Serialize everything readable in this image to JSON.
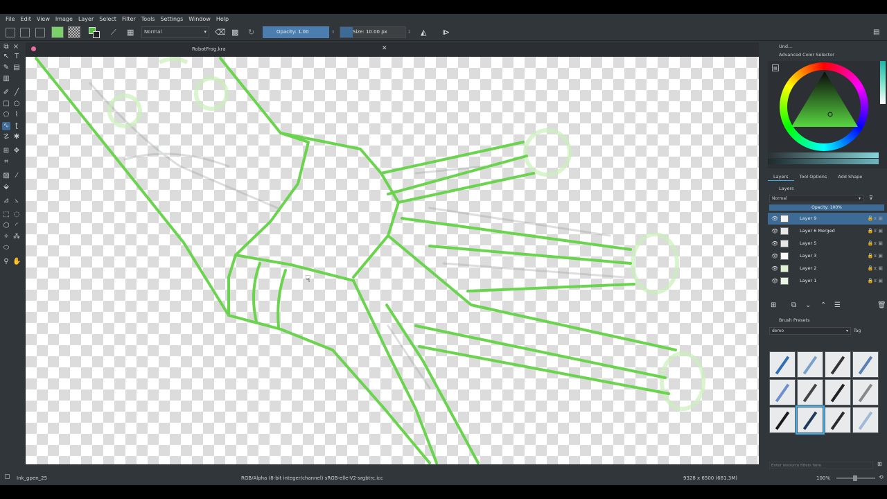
{
  "menu": [
    "File",
    "Edit",
    "View",
    "Image",
    "Layer",
    "Select",
    "Filter",
    "Tools",
    "Settings",
    "Window",
    "Help"
  ],
  "toolbar": {
    "blend_mode": "Normal",
    "opacity": "Opacity: 1.00",
    "size": "Size: 10.00 px",
    "fg_color": "#7bd06a"
  },
  "document": {
    "title": "RobotFrog.kra"
  },
  "docker": {
    "undo_title": "Und...",
    "color_selector_title": "Advanced Color Selector",
    "tabs": [
      "Layers",
      "Tool Options",
      "Add Shape"
    ],
    "layers_title": "Layers",
    "layer_blend": "Normal",
    "layer_opacity": "Opacity: 100%",
    "layers": [
      {
        "name": "Layer 9",
        "selected": true
      },
      {
        "name": "Layer 6 Merged",
        "selected": false
      },
      {
        "name": "Layer 5",
        "selected": false
      },
      {
        "name": "Layer 3",
        "selected": false
      },
      {
        "name": "Layer 2",
        "selected": false
      },
      {
        "name": "Layer 1",
        "selected": false
      }
    ],
    "brush_presets_title": "Brush Presets",
    "brush_tag": "demo",
    "brush_tag_button": "Tag",
    "filter_placeholder": "Enter resource filters here"
  },
  "status": {
    "brush_name": "Ink_gpen_25",
    "color_profile": "RGB/Alpha (8-bit integer/channel)  sRGB-elle-V2-srgbtrc.icc",
    "dimensions": "9328 x 6500 (681.3M)",
    "zoom": "100%"
  },
  "colors": {
    "accent": "#3d6b95",
    "stroke": "#6ad44e"
  }
}
